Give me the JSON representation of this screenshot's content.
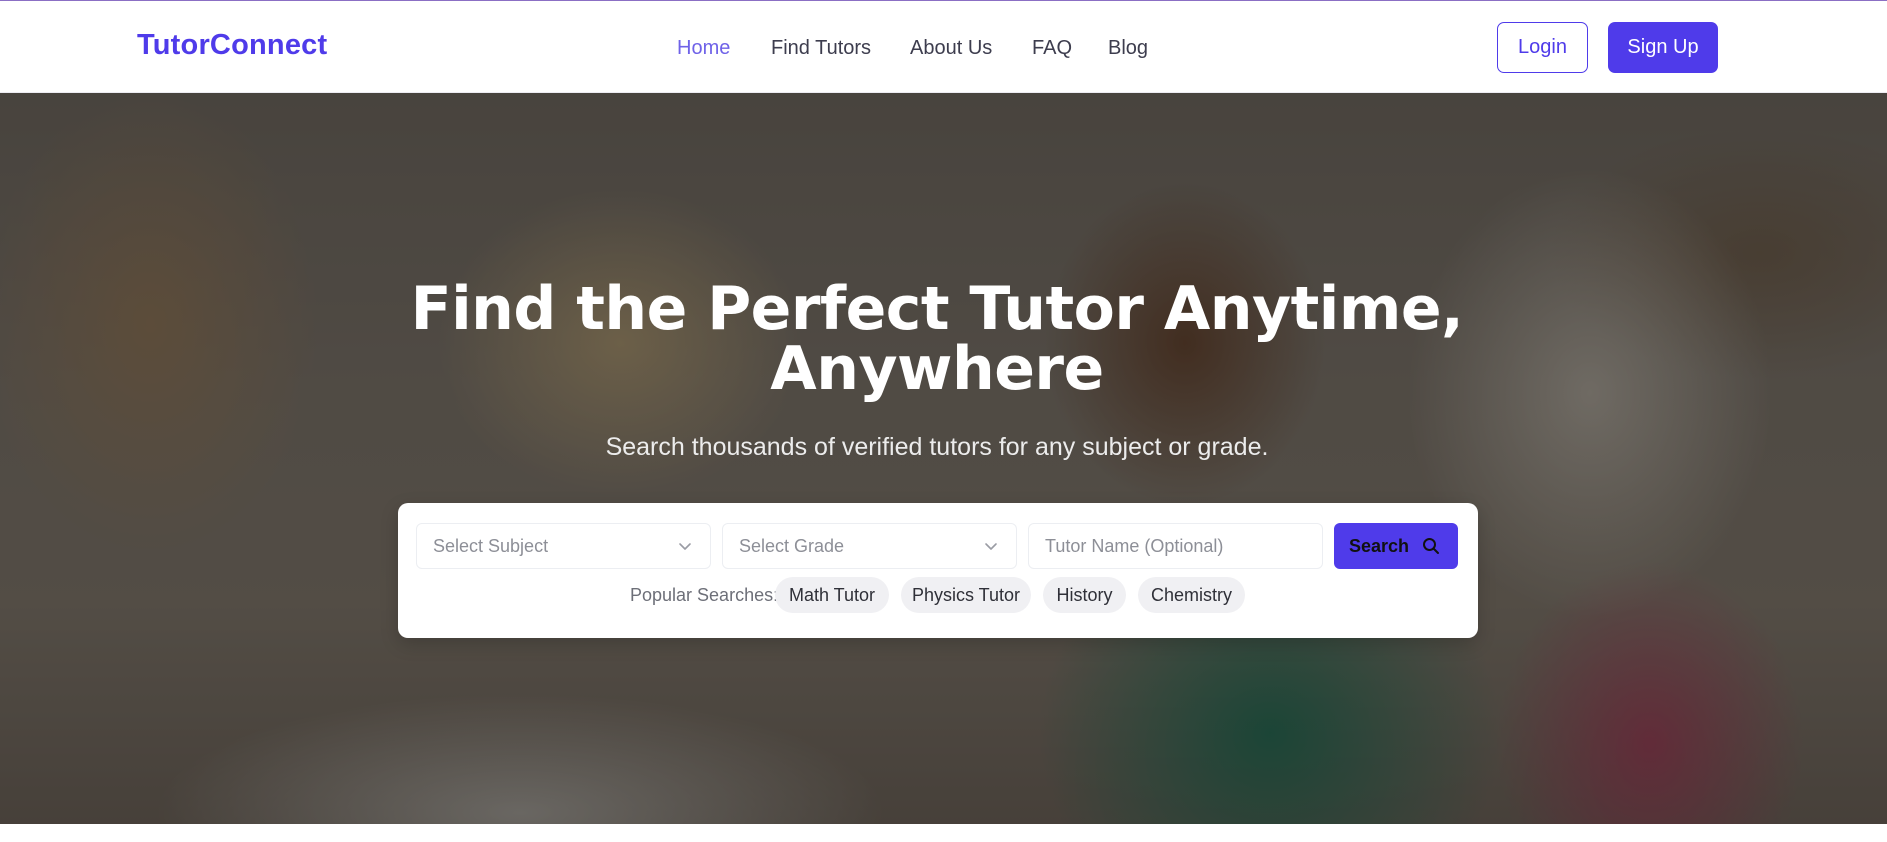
{
  "brand": {
    "name": "TutorConnect",
    "color": "#4f3bea"
  },
  "nav": {
    "items": [
      {
        "label": "Home",
        "active": true
      },
      {
        "label": "Find Tutors",
        "active": false
      },
      {
        "label": "About Us",
        "active": false
      },
      {
        "label": "FAQ",
        "active": false
      },
      {
        "label": "Blog",
        "active": false
      }
    ],
    "active_color": "#6f62e8"
  },
  "auth": {
    "login_label": "Login",
    "signup_label": "Sign Up",
    "accent": "#4f3bea"
  },
  "hero": {
    "title_line1": "Find the Perfect Tutor Anytime,",
    "title_line2": "Anywhere",
    "subtitle": "Search thousands of verified tutors for any subject or grade."
  },
  "search": {
    "subject_placeholder": "Select Subject",
    "grade_placeholder": "Select Grade",
    "tutor_name_placeholder": "Tutor Name (Optional)",
    "button_label": "Search",
    "button_color": "#4f3bea",
    "popular_label": "Popular Searches:",
    "popular": [
      "Math Tutor",
      "Physics Tutor",
      "History",
      "Chemistry"
    ]
  },
  "icons": [
    "chevron-down-icon",
    "search-icon"
  ]
}
